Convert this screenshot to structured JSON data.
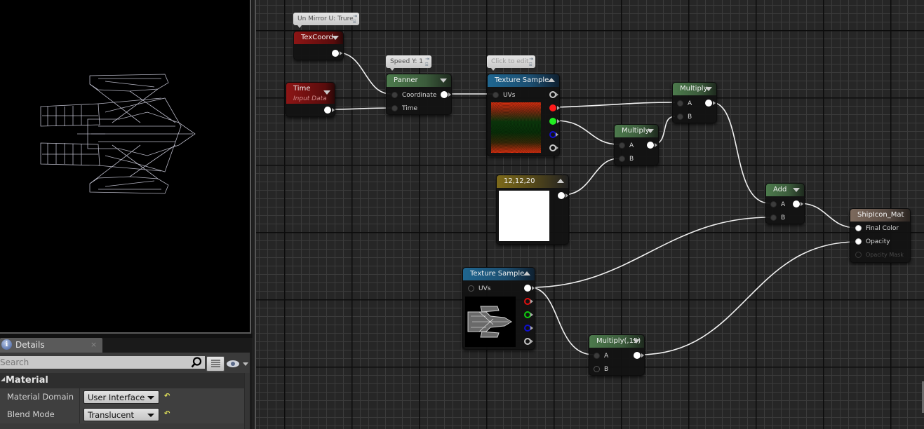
{
  "viewport": {
    "label": "Material preview viewport",
    "preview": "wireframe spaceship"
  },
  "details": {
    "tab_label": "Details",
    "tab_icon": "info-icon",
    "close_glyph": "×",
    "search_placeholder": "Search",
    "category": "Material",
    "properties": [
      {
        "name": "Material Domain",
        "value": "User Interface"
      },
      {
        "name": "Blend Mode",
        "value": "Translucent"
      }
    ],
    "reset_glyph": "↶"
  },
  "graph": {
    "comments": {
      "texcoord": "Un Mirror U: Trure",
      "panner": "Speed Y: 1",
      "texture_sample_1": "Click to edit"
    },
    "nodes": {
      "texcoord": {
        "title": "TexCoord"
      },
      "time": {
        "title": "Time",
        "subtitle": "Input Data"
      },
      "panner": {
        "title": "Panner",
        "inputs": [
          "Coordinate",
          "Time"
        ]
      },
      "texture_sample_1": {
        "title": "Texture Sample",
        "inputs": [
          "UVs"
        ],
        "outputs": [
          "RGB",
          "R",
          "G",
          "B",
          "A"
        ],
        "colors": {
          "r": "#ff1a1a",
          "g": "#22ee22",
          "b": "#1a1ad0"
        }
      },
      "multiply_1": {
        "title": "Multiply",
        "inputs": [
          "A",
          "B"
        ]
      },
      "multiply_2": {
        "title": "Multiply",
        "inputs": [
          "A",
          "B"
        ]
      },
      "constant3": {
        "title": "12,12,20",
        "color": "#ffffff"
      },
      "add": {
        "title": "Add",
        "inputs": [
          "A",
          "B"
        ]
      },
      "result": {
        "title": "ShipIcon_Mat",
        "inputs": [
          "Final Color",
          "Opacity",
          "Opacity Mask"
        ]
      },
      "texture_sample_2": {
        "title": "Texture Sample",
        "inputs": [
          "UVs"
        ],
        "outputs": [
          "RGB",
          "R",
          "G",
          "B",
          "A"
        ]
      },
      "multiply_15": {
        "title": "Multiply(,15)",
        "inputs": [
          "A",
          "B"
        ]
      }
    },
    "connections": [
      [
        "TexCoord.out",
        "Panner.Coordinate"
      ],
      [
        "Time.out",
        "Panner.Time"
      ],
      [
        "Panner.out",
        "Texture Sample.UVs"
      ],
      [
        "Texture Sample.R",
        "Multiply(top).A"
      ],
      [
        "Texture Sample.G",
        "Multiply(mid).A"
      ],
      [
        "12,12,20.out",
        "Multiply(mid).B"
      ],
      [
        "Multiply(mid).out",
        "Multiply(top).B"
      ],
      [
        "Multiply(top).out",
        "Add.A"
      ],
      [
        "Texture Sample(2).RGB",
        "Add.B"
      ],
      [
        "Texture Sample(2).RGB",
        "Multiply(,15).A"
      ],
      [
        "Add.out",
        "ShipIcon_Mat.Final Color"
      ],
      [
        "Multiply(,15).out",
        "ShipIcon_Mat.Opacity"
      ]
    ]
  }
}
